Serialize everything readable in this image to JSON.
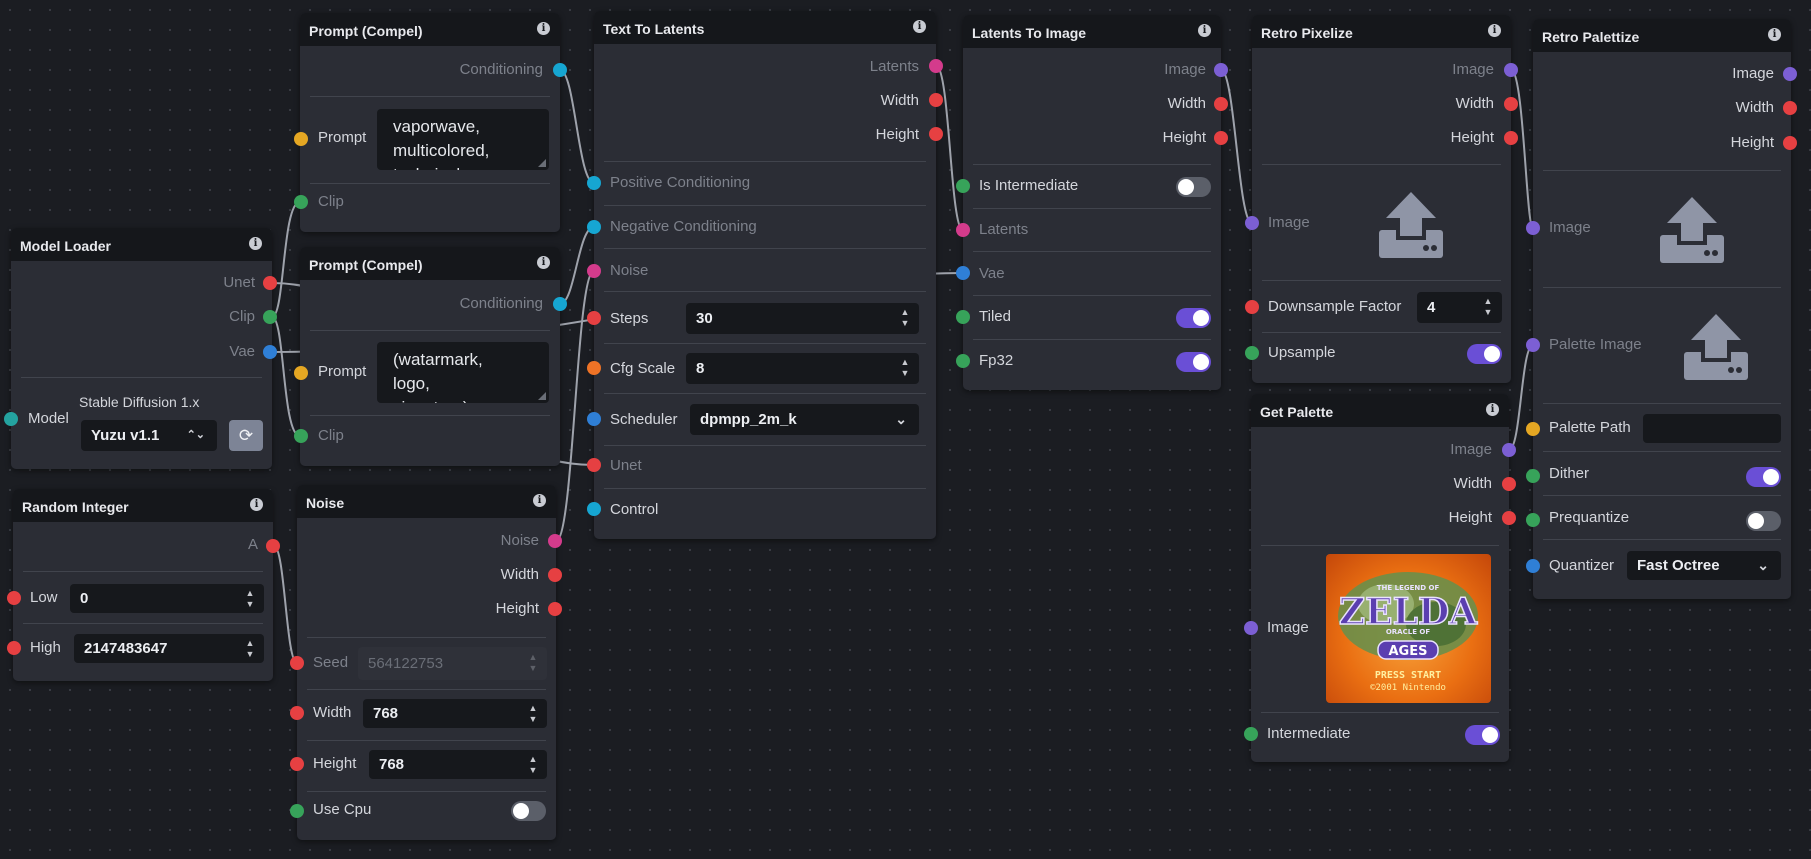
{
  "nodes": {
    "prompt1": {
      "title": "Prompt (Compel)",
      "out_conditioning": "Conditioning",
      "prompt_label": "Prompt",
      "prompt_text": "vaporwave,\nmulticolored,\ntechnicolor,",
      "clip_label": "Clip"
    },
    "prompt2": {
      "title": "Prompt (Compel)",
      "out_conditioning": "Conditioning",
      "prompt_label": "Prompt",
      "prompt_text": "(watarmark,\nlogo,\nsignature)",
      "clip_label": "Clip"
    },
    "model_loader": {
      "title": "Model Loader",
      "out_unet": "Unet",
      "out_clip": "Clip",
      "out_vae": "Vae",
      "model_label": "Model",
      "base_model": "Stable Diffusion 1.x",
      "model_value": "Yuzu v1.1"
    },
    "random_integer": {
      "title": "Random Integer",
      "out_a": "A",
      "low_label": "Low",
      "low_value": "0",
      "high_label": "High",
      "high_value": "2147483647"
    },
    "noise": {
      "title": "Noise",
      "out_noise": "Noise",
      "out_width": "Width",
      "out_height": "Height",
      "seed_label": "Seed",
      "seed_value": "564122753",
      "width_label": "Width",
      "width_value": "768",
      "height_label": "Height",
      "height_value": "768",
      "usecpu_label": "Use Cpu",
      "usecpu_on": false
    },
    "text_to_latents": {
      "title": "Text To Latents",
      "out_latents": "Latents",
      "out_width": "Width",
      "out_height": "Height",
      "pos_label": "Positive Conditioning",
      "neg_label": "Negative Conditioning",
      "noise_label": "Noise",
      "steps_label": "Steps",
      "steps_value": "30",
      "cfg_label": "Cfg Scale",
      "cfg_value": "8",
      "scheduler_label": "Scheduler",
      "scheduler_value": "dpmpp_2m_k",
      "unet_label": "Unet",
      "control_label": "Control"
    },
    "latents_to_image": {
      "title": "Latents To Image",
      "out_image": "Image",
      "out_width": "Width",
      "out_height": "Height",
      "intermediate_label": "Is Intermediate",
      "intermediate_on": false,
      "latents_label": "Latents",
      "vae_label": "Vae",
      "tiled_label": "Tiled",
      "tiled_on": true,
      "fp32_label": "Fp32",
      "fp32_on": true
    },
    "retro_pixelize": {
      "title": "Retro Pixelize",
      "out_image": "Image",
      "out_width": "Width",
      "out_height": "Height",
      "image_label": "Image",
      "downsample_label": "Downsample Factor",
      "downsample_value": "4",
      "upsample_label": "Upsample",
      "upsample_on": true
    },
    "get_palette": {
      "title": "Get Palette",
      "out_image": "Image",
      "out_width": "Width",
      "out_height": "Height",
      "image_label": "Image",
      "intermediate_label": "Intermediate",
      "intermediate_on": true,
      "thumb": {
        "line1": "THE LEGEND OF",
        "logo": "ZELDA",
        "line2": "ORACLE OF",
        "badge": "AGES",
        "press": "PRESS START",
        "copy": "©2001 Nintendo"
      }
    },
    "retro_palettize": {
      "title": "Retro Palettize",
      "out_image": "Image",
      "out_width": "Width",
      "out_height": "Height",
      "image_label": "Image",
      "palette_image_label": "Palette Image",
      "palette_path_label": "Palette Path",
      "palette_path_value": "",
      "dither_label": "Dither",
      "dither_on": true,
      "prequantize_label": "Prequantize",
      "prequantize_on": false,
      "quantizer_label": "Quantizer",
      "quantizer_value": "Fast Octree"
    }
  },
  "colors": {
    "canvas": "#1b1d22",
    "node_body": "#2b2d35",
    "node_header": "#15171b",
    "unet": "#e64042",
    "clip": "#37a35a",
    "vae": "#2f7fd6",
    "conditioning": "#16a6d2",
    "latents": "#d43b8c",
    "image": "#7c5fd4",
    "float": "#ee7326",
    "string": "#e5a723",
    "toggle_on": "#6a4fd6",
    "wire": "#9ea2ab"
  },
  "icons": {
    "info": "info-icon",
    "upload": "upload-icon",
    "refresh": "refresh-icon",
    "chevron": "chevron-down-icon",
    "stepper": "stepper-icon"
  }
}
